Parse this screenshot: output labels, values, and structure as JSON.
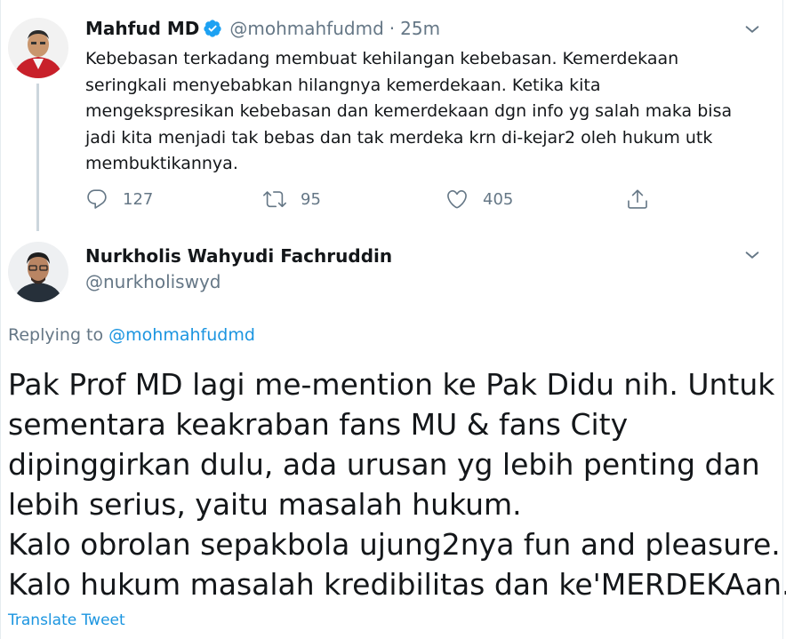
{
  "colors": {
    "text": "#14171a",
    "secondary": "#657786",
    "link": "#1b95e0",
    "verified": "#1da1f2",
    "thread_line": "#ccd6dd"
  },
  "parent_tweet": {
    "display_name": "Mahfud MD",
    "verified": true,
    "handle": "@mohmahfudmd",
    "separator": "·",
    "time": "25m",
    "text_lines": [
      "Kebebasan terkadang membuat kehilangan kebebasan. Kemerdekaan",
      "seringkali menyebabkan hilangnya kemerdekaan. Ketika kita",
      "mengekspresikan kebebasan dan kemerdekaan dgn info yg salah maka bisa",
      "jadi kita menjadi tak bebas dan tak merdeka krn di-kejar2 oleh hukum utk",
      "membuktikannya."
    ],
    "actions": {
      "reply_icon": "reply-icon",
      "reply_count": "127",
      "retweet_icon": "retweet-icon",
      "retweet_count": "95",
      "like_icon": "heart-icon",
      "like_count": "405",
      "share_icon": "share-icon"
    }
  },
  "reply_tweet": {
    "display_name": "Nurkholis Wahyudi Fachruddin",
    "handle": "@nurkholiswyd",
    "replying_to_label": "Replying to",
    "replying_to_handle": "@mohmahfudmd",
    "text_lines": [
      "Pak Prof MD lagi me-mention ke Pak Didu nih. Untuk",
      "sementara keakraban fans MU & fans City",
      "dipinggirkan dulu, ada urusan yg lebih penting dan",
      "lebih serius, yaitu masalah hukum.",
      "Kalo obrolan sepakbola ujung2nya fun and pleasure.",
      "Kalo hukum masalah kredibilitas dan ke'MERDEKAan."
    ],
    "translate_label": "Translate Tweet"
  }
}
